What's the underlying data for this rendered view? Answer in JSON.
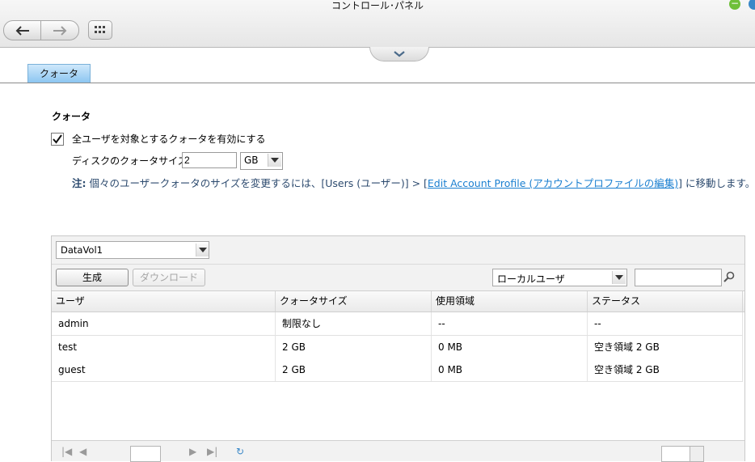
{
  "window": {
    "title": "コントロール･パネル"
  },
  "toolbar": {
    "back_icon": "arrow-left-icon",
    "forward_icon": "arrow-right-icon",
    "apps_icon": "grid-icon",
    "collapse_icon": "chevron-down-icon"
  },
  "tabs": [
    {
      "label": "クォータ",
      "active": true
    }
  ],
  "quota": {
    "section_title": "クォータ",
    "enable_label": "全ユーザを対象とするクォータを有効にする",
    "enable_checked": true,
    "size_label": "ディスクのクォータサイズ",
    "size_value": "2",
    "unit_value": "GB",
    "note_prefix": "注:",
    "note_text": "個々のユーザークォータのサイズを変更するには、[Users (ユーザー)] > [",
    "note_link": "Edit Account Profile (アカウントプロファイルの編集)",
    "note_suffix": "] に移動します。"
  },
  "grid": {
    "volume_value": "DataVol1",
    "create_label": "生成",
    "download_label": "ダウンロード",
    "user_type_value": "ローカルユーザ",
    "search_value": "",
    "columns": [
      "ユーザ",
      "クォータサイズ",
      "使用領域",
      "ステータス"
    ],
    "rows": [
      {
        "user": "admin",
        "quota": "制限なし",
        "used": "--",
        "status": "--"
      },
      {
        "user": "test",
        "quota": "2 GB",
        "used": "0 MB",
        "status": "空き領域 2 GB"
      },
      {
        "user": "guest",
        "quota": "2 GB",
        "used": "0 MB",
        "status": "空き領域 2 GB"
      }
    ]
  },
  "colors": {
    "accent_tab": "#8cc6f1",
    "link": "#1a7fd0",
    "note": "#2c4a6e"
  }
}
